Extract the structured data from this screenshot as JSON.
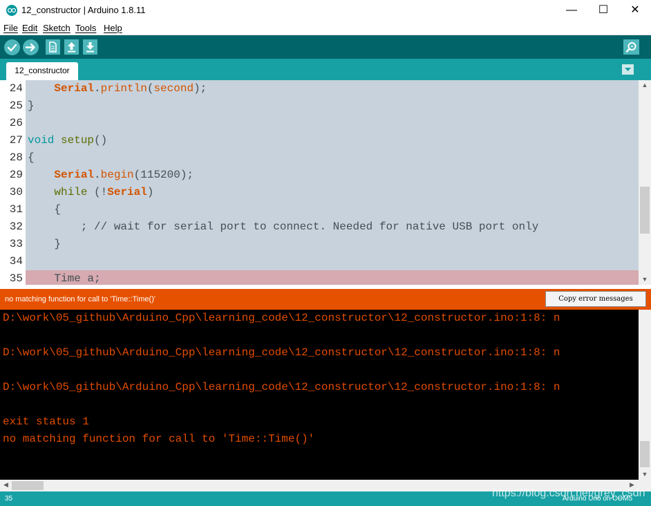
{
  "window": {
    "title": "12_constructor | Arduino 1.8.11",
    "minimize": "—",
    "maximize": "☐",
    "close": "✕"
  },
  "menu": [
    "File",
    "Edit",
    "Sketch",
    "Tools",
    "Help"
  ],
  "toolbar": {
    "buttons": [
      "verify-icon",
      "upload-icon",
      "new-icon",
      "open-icon",
      "save-icon",
      "serial-monitor-icon"
    ]
  },
  "tabs": [
    {
      "label": "12_constructor"
    }
  ],
  "editor": {
    "lines": [
      {
        "num": "24",
        "indent": "    ",
        "tokens": [
          {
            "t": "Serial",
            "c": "kw-serial"
          },
          {
            "t": ".",
            "c": ""
          },
          {
            "t": "println",
            "c": "fn-orange"
          },
          {
            "t": "(",
            "c": ""
          },
          {
            "t": "second",
            "c": "fn-orange"
          },
          {
            "t": ");",
            "c": ""
          }
        ]
      },
      {
        "num": "25",
        "indent": "",
        "tokens": [
          {
            "t": "}",
            "c": ""
          }
        ]
      },
      {
        "num": "26",
        "indent": "",
        "tokens": []
      },
      {
        "num": "27",
        "indent": "",
        "tokens": [
          {
            "t": "void",
            "c": "kw-type"
          },
          {
            "t": " ",
            "c": ""
          },
          {
            "t": "setup",
            "c": "kw-func"
          },
          {
            "t": "()",
            "c": ""
          }
        ]
      },
      {
        "num": "28",
        "indent": "",
        "tokens": [
          {
            "t": "{",
            "c": ""
          }
        ]
      },
      {
        "num": "29",
        "indent": "    ",
        "tokens": [
          {
            "t": "Serial",
            "c": "kw-serial"
          },
          {
            "t": ".",
            "c": ""
          },
          {
            "t": "begin",
            "c": "fn-orange"
          },
          {
            "t": "(115200);",
            "c": ""
          }
        ]
      },
      {
        "num": "30",
        "indent": "    ",
        "tokens": [
          {
            "t": "while",
            "c": "kw-func"
          },
          {
            "t": " (!",
            "c": ""
          },
          {
            "t": "Serial",
            "c": "kw-serial"
          },
          {
            "t": ")",
            "c": ""
          }
        ]
      },
      {
        "num": "31",
        "indent": "    ",
        "tokens": [
          {
            "t": "{",
            "c": ""
          }
        ]
      },
      {
        "num": "32",
        "indent": "        ",
        "tokens": [
          {
            "t": "; // wait for serial port to connect. Needed for native USB port only",
            "c": ""
          }
        ]
      },
      {
        "num": "33",
        "indent": "    ",
        "tokens": [
          {
            "t": "}",
            "c": ""
          }
        ]
      },
      {
        "num": "34",
        "indent": "",
        "tokens": []
      },
      {
        "num": "35",
        "indent": "    ",
        "highlight": true,
        "tokens": [
          {
            "t": "Time a;",
            "c": ""
          }
        ]
      }
    ]
  },
  "error": {
    "message": "no matching function for call to 'Time::Time()'",
    "copy_button": "Copy error messages"
  },
  "console": {
    "lines": [
      "D:\\work\\05_github\\Arduino_Cpp\\learning_code\\12_constructor\\12_constructor.ino:1:8: n",
      "",
      "D:\\work\\05_github\\Arduino_Cpp\\learning_code\\12_constructor\\12_constructor.ino:1:8: n",
      "",
      "D:\\work\\05_github\\Arduino_Cpp\\learning_code\\12_constructor\\12_constructor.ino:1:8: n",
      "",
      "exit status 1",
      "no matching function for call to 'Time::Time()'"
    ]
  },
  "status": {
    "line": "35",
    "board": "Arduino Uno on COM5"
  },
  "watermark": "https://blog.csdn.net/grey_csdn",
  "colors": {
    "toolbar": "#006468",
    "tabbar": "#17a1a5",
    "error_bar": "#e65100",
    "console_text": "#e34c00"
  }
}
